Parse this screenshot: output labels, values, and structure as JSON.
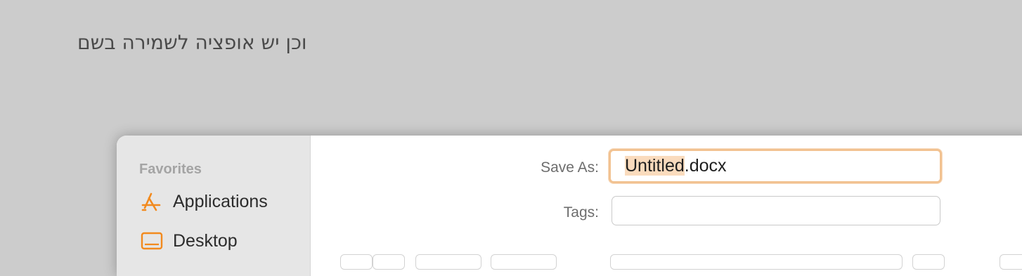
{
  "caption": "וכן יש אופציה לשמירה בשם",
  "sidebar": {
    "section_title": "Favorites",
    "items": [
      {
        "label": "Applications",
        "icon": "applications-icon"
      },
      {
        "label": "Desktop",
        "icon": "desktop-icon"
      }
    ]
  },
  "form": {
    "save_as_label": "Save As:",
    "filename_selected": "Untitled",
    "filename_ext": ".docx",
    "tags_label": "Tags:",
    "tags_value": ""
  },
  "colors": {
    "accent": "#f28a1e",
    "selection": "#fadbbd",
    "focus_ring": "#f2c291"
  }
}
